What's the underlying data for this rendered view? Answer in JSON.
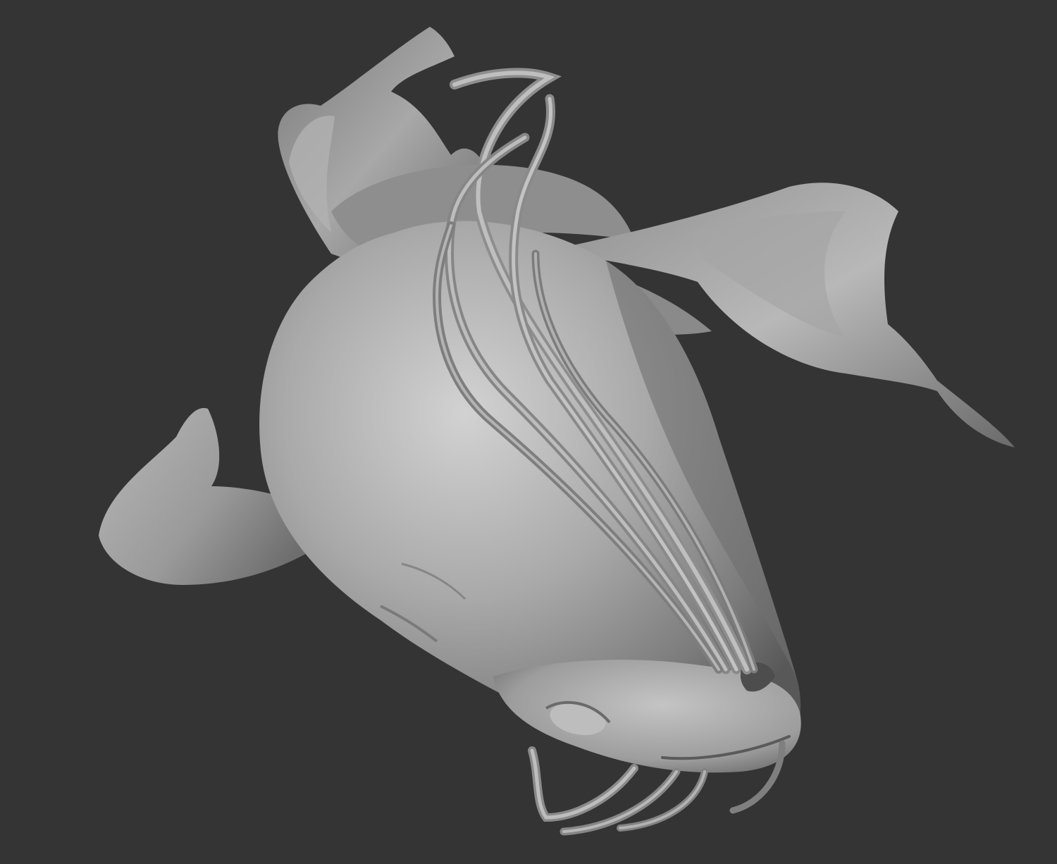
{
  "scene": {
    "subject": "catfish-sculpt",
    "render_style": "grey-clay-matcap",
    "colors": {
      "background": "#343434",
      "clay_light": "#c9c9c9",
      "clay_mid": "#9c9c9c",
      "clay_dark": "#5e5e5e",
      "clay_shadow": "#3f3f3f"
    }
  }
}
